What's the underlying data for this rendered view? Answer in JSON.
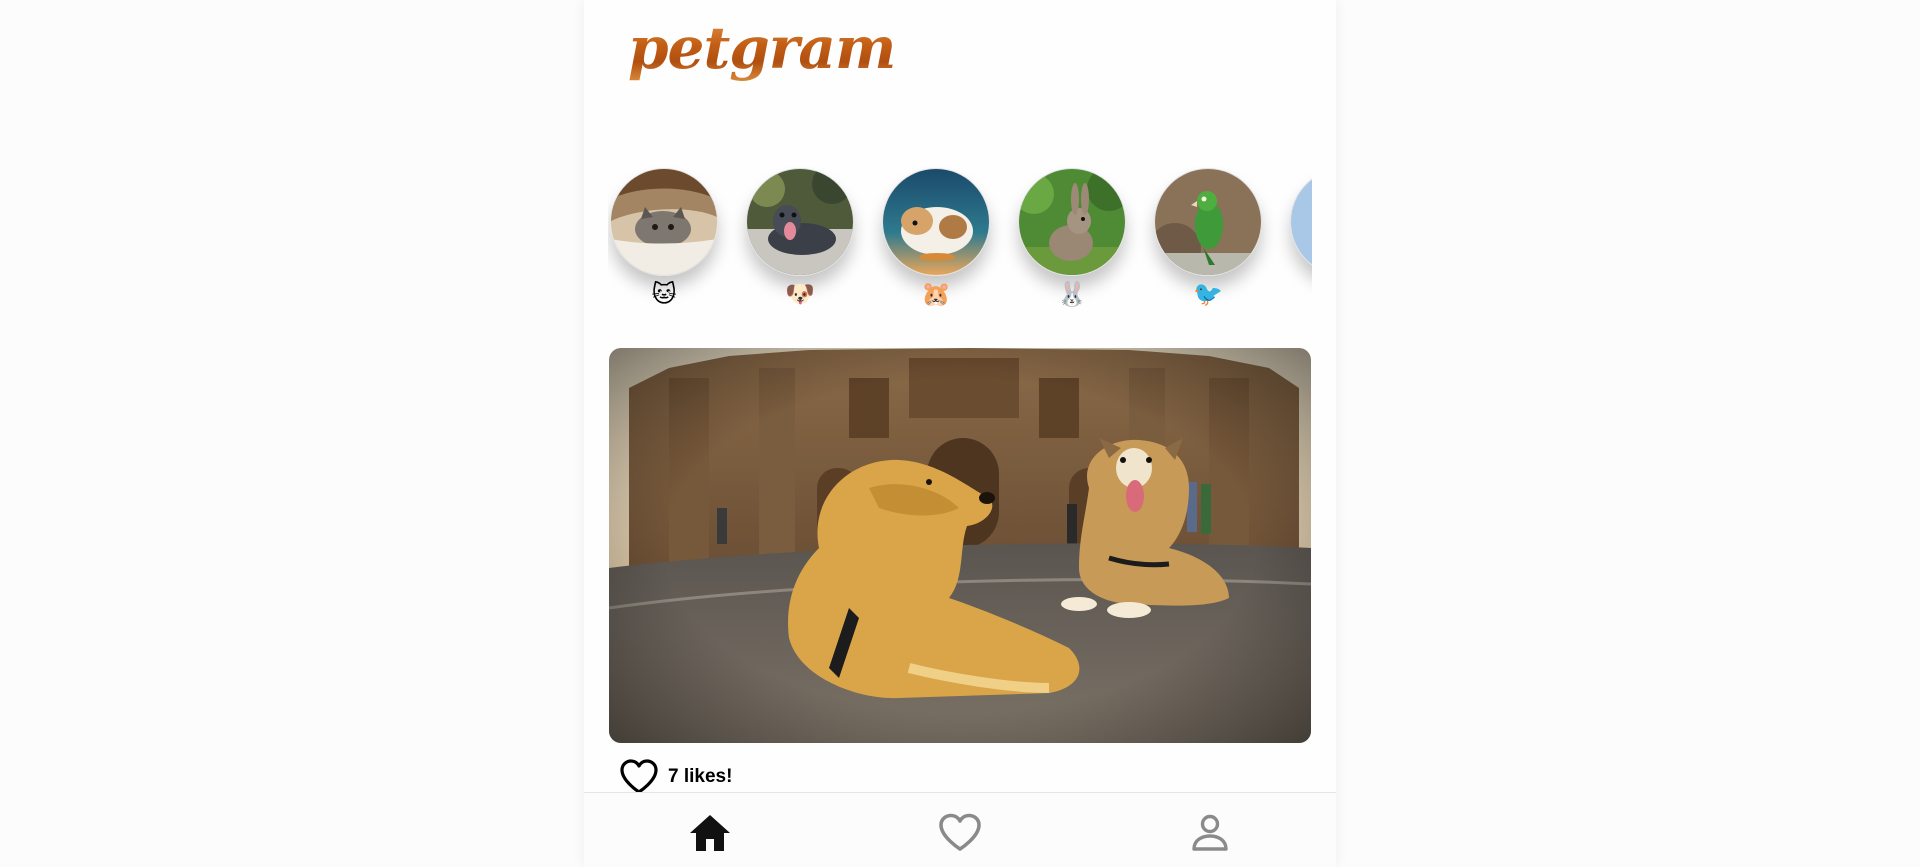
{
  "app": {
    "logo_text": "petgram"
  },
  "categories": [
    {
      "name": "cat-category",
      "emoji": "🐱",
      "photo": "cat-under-blanket-photo"
    },
    {
      "name": "dog-category",
      "emoji": "🐶",
      "photo": "dog-lying-photo"
    },
    {
      "name": "hamster-category",
      "emoji": "🐹",
      "photo": "hamster-photo"
    },
    {
      "name": "rabbit-category",
      "emoji": "🐰",
      "photo": "rabbit-photo"
    },
    {
      "name": "bird-category",
      "emoji": "🐦",
      "photo": "parrot-photo"
    }
  ],
  "post": {
    "photo": "two-dogs-in-front-of-cathedral-photo",
    "likes_label": "7 likes!",
    "like_icon": "heart-outline-icon"
  },
  "bottom_nav": {
    "items": [
      {
        "name": "home",
        "icon": "home-icon",
        "active": true
      },
      {
        "name": "favorites",
        "icon": "heart-icon",
        "active": false
      },
      {
        "name": "user",
        "icon": "user-icon",
        "active": false
      }
    ]
  },
  "colors": {
    "logo": "#c9661c",
    "background": "#fcfcfc",
    "active_nav": "#111111",
    "inactive_nav": "#8a8a8a"
  }
}
